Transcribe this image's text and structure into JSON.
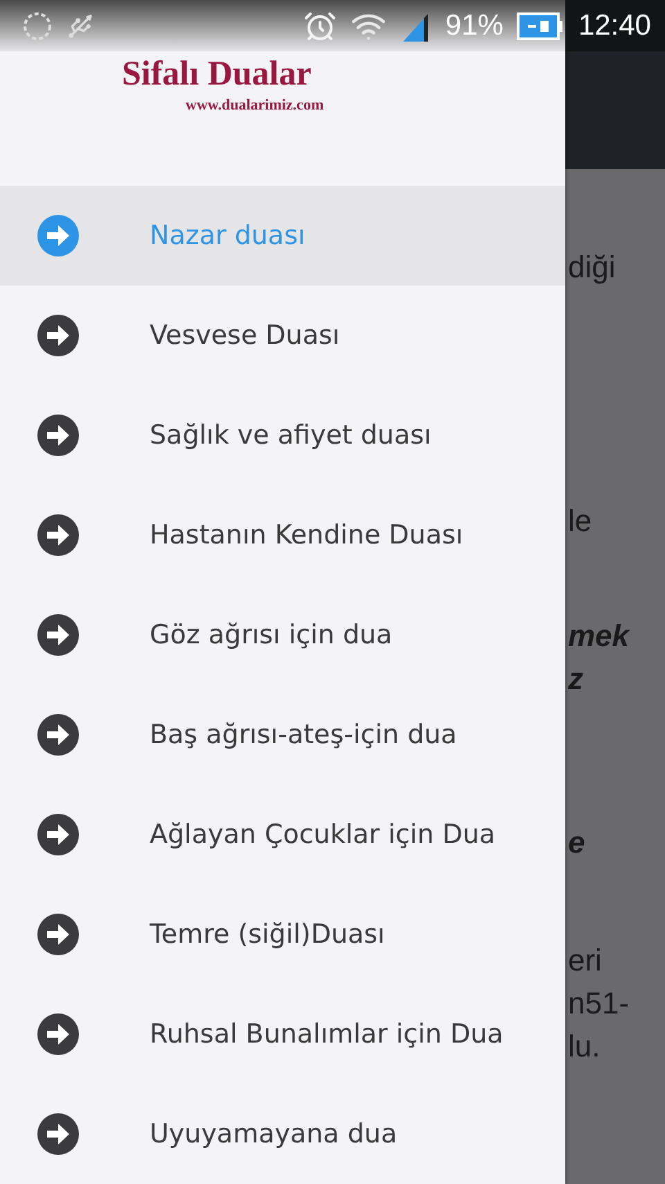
{
  "status_bar": {
    "battery": "91%",
    "time": "12:40"
  },
  "drawer": {
    "logo_title": "Sifalı Dualar",
    "logo_url": "www.dualarimiz.com",
    "items": [
      {
        "label": "Nazar duası",
        "selected": true
      },
      {
        "label": "Vesvese Duası",
        "selected": false
      },
      {
        "label": "Sağlık ve afiyet duası",
        "selected": false
      },
      {
        "label": "Hastanın Kendine Duası",
        "selected": false
      },
      {
        "label": "Göz ağrısı için dua",
        "selected": false
      },
      {
        "label": "Baş ağrısı-ateş-için dua",
        "selected": false
      },
      {
        "label": "Ağlayan Çocuklar için Dua",
        "selected": false
      },
      {
        "label": "Temre (siğil)Duası",
        "selected": false
      },
      {
        "label": "Ruhsal Bunalımlar için Dua",
        "selected": false
      },
      {
        "label": "Uyuyamayana dua",
        "selected": false
      }
    ]
  },
  "content": {
    "paragraphs": [
      {
        "lines": [
          "diği"
        ],
        "bold": false
      },
      {
        "lines": [
          "le"
        ],
        "bold": false
      },
      {
        "lines": [
          "mek",
          "z"
        ],
        "bold": true
      },
      {
        "lines": [
          "e"
        ],
        "bold": true
      },
      {
        "lines": [
          "eri",
          "n51-",
          "lu."
        ],
        "bold": false
      }
    ]
  }
}
